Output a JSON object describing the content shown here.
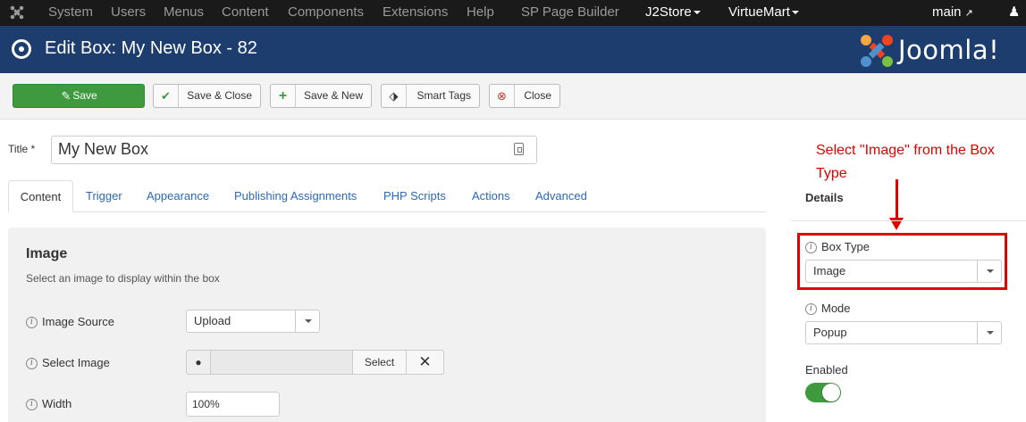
{
  "topnav": {
    "items": [
      "System",
      "Users",
      "Menus",
      "Content",
      "Components",
      "Extensions",
      "Help",
      "SP Page Builder",
      "J2Store",
      "VirtueMart"
    ],
    "user": "main"
  },
  "header": {
    "title": "Edit Box: My New Box - 82",
    "logo_text": "Joomla!"
  },
  "toolbar": {
    "save": "Save",
    "save_close": "Save & Close",
    "save_new": "Save & New",
    "smart_tags": "Smart Tags",
    "close": "Close"
  },
  "form": {
    "title_label": "Title *",
    "title_value": "My New Box"
  },
  "tabs": [
    "Content",
    "Trigger",
    "Appearance",
    "Publishing Assignments",
    "PHP Scripts",
    "Actions",
    "Advanced"
  ],
  "panel": {
    "title": "Image",
    "description": "Select an image to display within the box",
    "image_source_label": "Image Source",
    "image_source_value": "Upload",
    "select_image_label": "Select Image",
    "select_button": "Select",
    "width_label": "Width",
    "width_value": "100%"
  },
  "sidebar": {
    "annotation": "Select \"Image\" from the Box Type",
    "details_title": "Details",
    "box_type_label": "Box Type",
    "box_type_value": "Image",
    "mode_label": "Mode",
    "mode_value": "Popup",
    "enabled_label": "Enabled"
  },
  "colors": {
    "header_bg": "#1c3d6d",
    "save_green": "#3f9a3f",
    "link_blue": "#2a69b8",
    "annotation_red": "#e00000"
  }
}
